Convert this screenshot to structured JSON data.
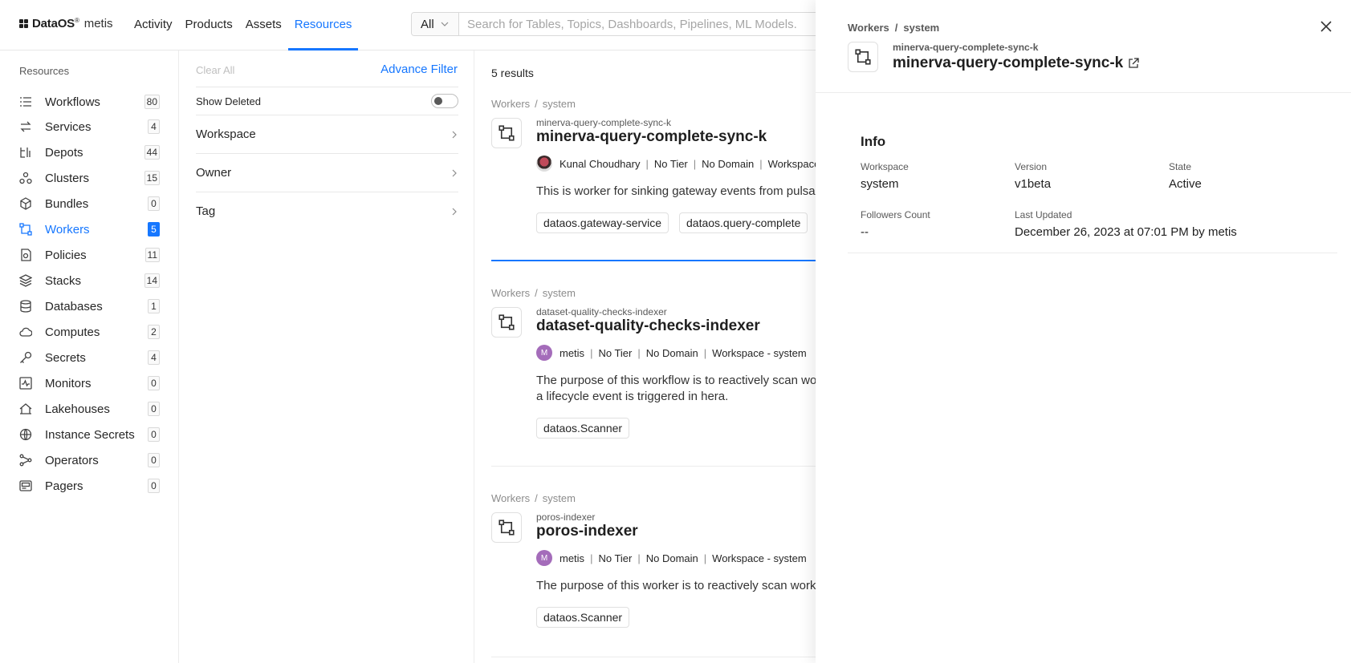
{
  "brand": {
    "name": "DataOS",
    "mark": "®",
    "product": "metis"
  },
  "nav": {
    "links": [
      "Activity",
      "Products",
      "Assets",
      "Resources"
    ],
    "active": "Resources"
  },
  "search": {
    "scope": "All",
    "placeholder": "Search for Tables, Topics, Dashboards, Pipelines, ML Models."
  },
  "sidebar": {
    "heading": "Resources",
    "items": [
      {
        "label": "Workflows",
        "count": "80",
        "icon": "workflows-icon"
      },
      {
        "label": "Services",
        "count": "4",
        "icon": "services-icon"
      },
      {
        "label": "Depots",
        "count": "44",
        "icon": "depots-icon"
      },
      {
        "label": "Clusters",
        "count": "15",
        "icon": "clusters-icon"
      },
      {
        "label": "Bundles",
        "count": "0",
        "icon": "bundles-icon"
      },
      {
        "label": "Workers",
        "count": "5",
        "icon": "workers-icon",
        "active": true
      },
      {
        "label": "Policies",
        "count": "11",
        "icon": "policies-icon"
      },
      {
        "label": "Stacks",
        "count": "14",
        "icon": "stacks-icon"
      },
      {
        "label": "Databases",
        "count": "1",
        "icon": "databases-icon"
      },
      {
        "label": "Computes",
        "count": "2",
        "icon": "computes-icon"
      },
      {
        "label": "Secrets",
        "count": "4",
        "icon": "secrets-icon"
      },
      {
        "label": "Monitors",
        "count": "0",
        "icon": "monitors-icon"
      },
      {
        "label": "Lakehouses",
        "count": "0",
        "icon": "lakehouses-icon"
      },
      {
        "label": "Instance Secrets",
        "count": "0",
        "icon": "instance-secrets-icon"
      },
      {
        "label": "Operators",
        "count": "0",
        "icon": "operators-icon"
      },
      {
        "label": "Pagers",
        "count": "0",
        "icon": "pagers-icon"
      }
    ]
  },
  "filters": {
    "clear_all": "Clear All",
    "advance_filter": "Advance Filter",
    "show_deleted": "Show Deleted",
    "show_deleted_on": false,
    "groups": [
      "Workspace",
      "Owner",
      "Tag"
    ]
  },
  "results": {
    "count_text": "5 results",
    "cards": [
      {
        "crumb": [
          "Workers",
          "system"
        ],
        "sub": "minerva-query-complete-sync-k",
        "title": "minerva-query-complete-sync-k",
        "owner": "Kunal Choudhary",
        "avatar": "",
        "tier": "No Tier",
        "domain": "No Domain",
        "workspace": "Workspace -",
        "description": "This is worker for sinking gateway events from pulsar",
        "tags": [
          "dataos.gateway-service",
          "dataos.query-complete"
        ]
      },
      {
        "crumb": [
          "Workers",
          "system"
        ],
        "sub": "dataset-quality-checks-indexer",
        "title": "dataset-quality-checks-indexer",
        "owner": "metis",
        "avatar": "M",
        "tier": "No Tier",
        "domain": "No Domain",
        "workspace": "Workspace -  system",
        "description": "The purpose of this workflow is to reactively scan wo",
        "description2": "a lifecycle event is triggered in hera.",
        "tags": [
          "dataos.Scanner"
        ]
      },
      {
        "crumb": [
          "Workers",
          "system"
        ],
        "sub": "poros-indexer",
        "title": "poros-indexer",
        "owner": "metis",
        "avatar": "M",
        "tier": "No Tier",
        "domain": "No Domain",
        "workspace": "Workspace -  system",
        "description": "The purpose of this worker is to reactively scan work",
        "tags": [
          "dataos.Scanner"
        ]
      }
    ]
  },
  "panel": {
    "crumb": [
      "Workers",
      "system"
    ],
    "sub": "minerva-query-complete-sync-k",
    "title": "minerva-query-complete-sync-k",
    "info": {
      "heading": "Info",
      "workspace_label": "Workspace",
      "workspace": "system",
      "version_label": "Version",
      "version": "v1beta",
      "state_label": "State",
      "state": "Active",
      "followers_label": "Followers Count",
      "followers": "--",
      "updated_label": "Last Updated",
      "updated": "December 26, 2023 at 07:01 PM by metis"
    }
  },
  "colors": {
    "accent": "#1677ff",
    "avatar": "#a46cba"
  }
}
